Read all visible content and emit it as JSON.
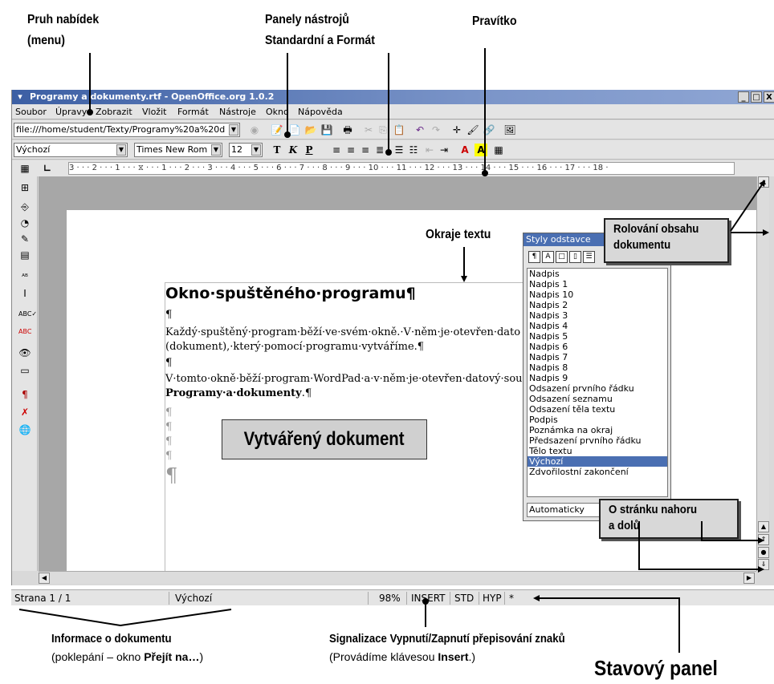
{
  "annotations": {
    "menu_label_1": "Pruh nabídek",
    "menu_label_2": "(menu)",
    "toolbars_label_1": "Panely nástrojů",
    "toolbars_label_2": "Standardní a Formát",
    "ruler_label": "Pravítko",
    "margins_label": "Okraje textu",
    "scrolling_label_1": "Rolování obsahu",
    "scrolling_label_2": "dokumentu",
    "pageupdown_label_1": "O stránku nahoru",
    "pageupdown_label_2": "a dolů",
    "docinfo_title": "Informace o dokumentu",
    "docinfo_note_pre": "(poklepání – okno ",
    "docinfo_note_bold": "Přejít na…",
    "docinfo_note_post": ")",
    "insert_title": "Signalizace Vypnutí/Zapnutí přepisování znaků",
    "insert_note_pre": "(Provádíme klávesou ",
    "insert_note_bold": "Insert",
    "insert_note_post": ".)",
    "statusbar_label": "Stavový panel"
  },
  "window": {
    "title": "Programy a dokumenty.rtf - OpenOffice.org 1.0.2",
    "sysmenu": "▾",
    "minimize": "_",
    "maximize": "□",
    "close": "X"
  },
  "menu": {
    "items": [
      "Soubor",
      "Úpravy",
      "Zobrazit",
      "Vložit",
      "Formát",
      "Nástroje",
      "Okno",
      "Nápověda"
    ]
  },
  "standard_toolbar": {
    "url": "file:///home/student/Texty/Programy%20a%20d"
  },
  "format_toolbar": {
    "paragraph_style": "Výchozí",
    "font_name": "Times New Rom",
    "font_size": "12",
    "bold": "T",
    "italic": "K",
    "underline": "P"
  },
  "ruler": {
    "text": "3 · · · 2 · · · 1 · · · ⧖ · · · 1 · · · 2 · · · 3 · · · 4 · · · 5 · · · 6 · · · 7 · · · 8 · · · 9 · · · 10 · · · 11 · · · 12 · · · 13 · · · 14 · · · 15 · · · 16 · · · 17 · · · 18 ·"
  },
  "document": {
    "heading": "Okno·spuštěného·programu¶",
    "pilcrow": "¶",
    "para1_line1": "Každý·spuštěný·program·běží·ve·svém·okně.·V·něm·je·otevřen·dato",
    "para1_line2": "(dokument),·který·pomocí·programu·vytváříme.¶",
    "para2_line1": "V·tomto·okně·běží·program·WordPad·a·v·něm·je·otevřen·datový·sou",
    "para2_line2_bold": "Programy·a·dokumenty",
    "para2_line2_end": ".¶",
    "created_doc_box": "Vytvářený dokument"
  },
  "stylist": {
    "title": "Styly odstavce",
    "styles": [
      "Nadpis",
      "Nadpis 1",
      "Nadpis 10",
      "Nadpis 2",
      "Nadpis 3",
      "Nadpis 4",
      "Nadpis 5",
      "Nadpis 6",
      "Nadpis 7",
      "Nadpis 8",
      "Nadpis 9",
      "Odsazení prvního řádku",
      "Odsazení seznamu",
      "Odsazení těla textu",
      "Podpis",
      "Poznámka na okraj",
      "Předsazení prvního řádku",
      "Tělo textu",
      "Výchozí",
      "Zdvořilostní zakončení"
    ],
    "selected": "Výchozí",
    "filter": "Automaticky"
  },
  "statusbar": {
    "page": "Strana 1 / 1",
    "style": "Výchozí",
    "zoom": "98%",
    "insert": "INSERT",
    "std": "STD",
    "hyp": "HYP",
    "modified": "*"
  },
  "colors": {
    "titlebar": "#3c5fa4",
    "selection": "#4a6fb2",
    "page_background": "#a7a7a7"
  }
}
